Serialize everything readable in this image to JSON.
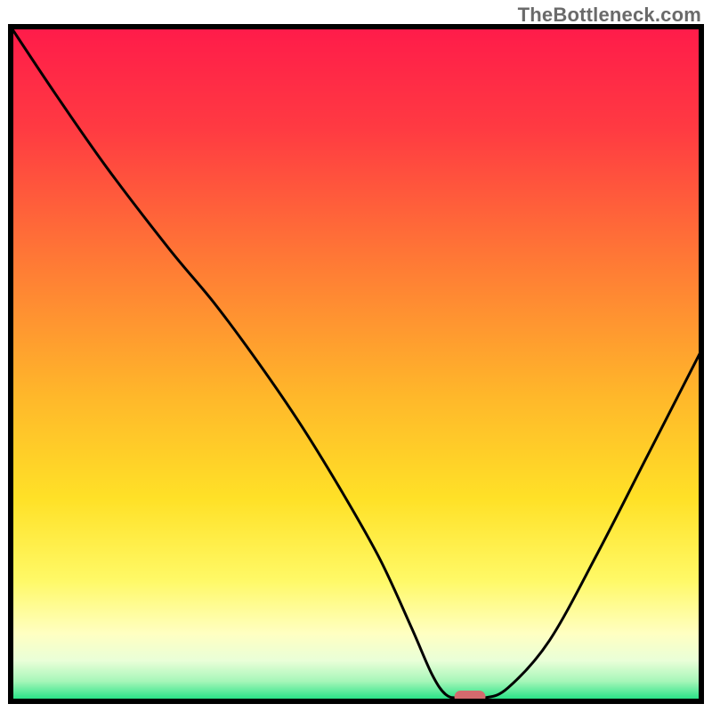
{
  "watermark": "TheBottleneck.com",
  "chart_data": {
    "type": "line",
    "title": "",
    "xlabel": "",
    "ylabel": "",
    "xlim": [
      0,
      100
    ],
    "ylim": [
      0,
      100
    ],
    "grid": false,
    "series": [
      {
        "name": "bottleneck-curve",
        "x": [
          0.0,
          6.5,
          14.0,
          23.0,
          29.5,
          36.0,
          42.0,
          48.0,
          53.5,
          58.0,
          61.0,
          63.0,
          65.0,
          68.5,
          72.0,
          78.0,
          85.0,
          92.0,
          100.0
        ],
        "y": [
          100.0,
          90.0,
          79.0,
          67.0,
          59.0,
          50.0,
          41.0,
          31.0,
          21.0,
          11.0,
          4.0,
          1.0,
          0.5,
          0.5,
          2.0,
          9.0,
          22.0,
          36.0,
          52.0
        ]
      }
    ],
    "marker": {
      "name": "optimal-point",
      "x": 66.5,
      "y": 0.0,
      "width": 4.5,
      "color": "#d36a6e"
    },
    "gradient_stops": [
      {
        "offset": 0.0,
        "color": "#ff1b4a"
      },
      {
        "offset": 0.15,
        "color": "#ff3a42"
      },
      {
        "offset": 0.35,
        "color": "#ff7a35"
      },
      {
        "offset": 0.55,
        "color": "#ffb82a"
      },
      {
        "offset": 0.7,
        "color": "#ffe127"
      },
      {
        "offset": 0.82,
        "color": "#fff966"
      },
      {
        "offset": 0.9,
        "color": "#ffffc2"
      },
      {
        "offset": 0.94,
        "color": "#e9ffd8"
      },
      {
        "offset": 0.97,
        "color": "#a7f6b9"
      },
      {
        "offset": 1.0,
        "color": "#17e080"
      }
    ],
    "frame": {
      "inner_x": 12,
      "inner_y": 30,
      "inner_w": 776,
      "inner_h": 758,
      "stroke": "#000000",
      "stroke_width": 6
    }
  }
}
